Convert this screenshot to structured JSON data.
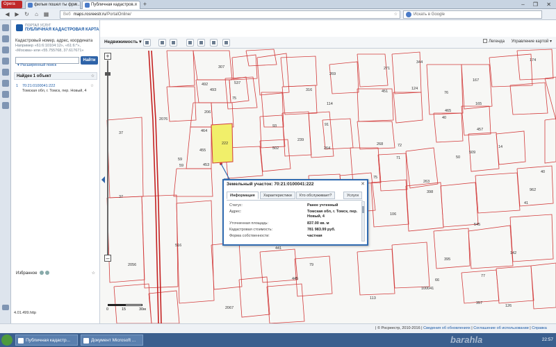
{
  "browser": {
    "opera_label": "Opera",
    "tabs": [
      {
        "label": "фильм пошел ты фри..."
      },
      {
        "label": "Публичная кадастров..."
      }
    ],
    "new_tab": "+",
    "window_controls": "– ❐ ✕",
    "address": {
      "label": "Веб",
      "domain": "maps.rosreestr.ru",
      "path": "/PortalOnline/"
    },
    "search_placeholder": "Искать в Google"
  },
  "portal": {
    "line1": "ПОРТАЛ УСЛУГ",
    "line2": "ПУБЛИЧНАЯ КАДАСТРОВАЯ КАРТА"
  },
  "search": {
    "hint_title": "Кадастровый номер, адрес, координата",
    "hint_example1": "Например «61:6:10104:12», «61:6:*»,",
    "hint_example2": "«Москва» или «55.755768, 37.617671»",
    "input_value": "",
    "find_label": "Найти",
    "advanced_label": "▾ Расширенный поиск"
  },
  "results": {
    "header": "Найден 1 объект",
    "items": [
      {
        "index": "1",
        "number": "70:21:0100041:222",
        "address": "Томская обл, г. Томск, пер. Новый, 4"
      }
    ]
  },
  "favorites": {
    "label": "Избранное"
  },
  "version": "4.01.499.http",
  "toolbar": {
    "layer_label": "Недвижимость ▾",
    "legend_label": "Легенда",
    "map_control_label": "Управление картой ▾"
  },
  "scale": {
    "l0": "0",
    "l1": "15",
    "l2": "30м"
  },
  "popup": {
    "title": "Земельный участок: 70:21:0100041:222",
    "close": "✕",
    "tabs": [
      {
        "label": "Информация"
      },
      {
        "label": "Характеристики"
      },
      {
        "label": "Кто обслуживает?"
      },
      {
        "label": "Услуги"
      }
    ],
    "rows": [
      {
        "key": "Статус:",
        "value": "Ранее учтенный"
      },
      {
        "key": "Адрес:",
        "value": "Томская обл, г. Томск, пер. Новый, 4"
      },
      {
        "key": "Уточненная площадь:",
        "value": "837.00 кв. м"
      },
      {
        "key": "Кадастровая стоимость:",
        "value": "781 983.99 руб."
      },
      {
        "key": "Форма собственности:",
        "value": "частная"
      }
    ]
  },
  "status": {
    "left": "",
    "copyright": "| © Росреестр, 2010-2016 |",
    "links": [
      "Сведения об обновлениях",
      "Соглашение об использовании",
      "Справка"
    ]
  },
  "taskbar": {
    "items": [
      {
        "label": "Публичная кадастр..."
      },
      {
        "label": "Документ Microsoft ..."
      }
    ],
    "time": "22:57"
  },
  "watermark": "barahla",
  "parcels": [
    {
      "label": "307"
    },
    {
      "label": "537"
    },
    {
      "label": "493"
    },
    {
      "label": "492"
    },
    {
      "label": "206"
    },
    {
      "label": "464"
    },
    {
      "label": "222"
    },
    {
      "label": "455"
    },
    {
      "label": "453"
    },
    {
      "label": "59"
    },
    {
      "label": "59"
    },
    {
      "label": "37"
    },
    {
      "label": "37"
    },
    {
      "label": "2076"
    },
    {
      "label": "516"
    },
    {
      "label": "2056"
    },
    {
      "label": "2067"
    },
    {
      "label": "75"
    },
    {
      "label": "269"
    },
    {
      "label": "316"
    },
    {
      "label": "114"
    },
    {
      "label": "93"
    },
    {
      "label": "91"
    },
    {
      "label": "239"
    },
    {
      "label": "502"
    },
    {
      "label": "264"
    },
    {
      "label": "271"
    },
    {
      "label": "344"
    },
    {
      "label": "451"
    },
    {
      "label": "124"
    },
    {
      "label": "76"
    },
    {
      "label": "465"
    },
    {
      "label": "174"
    },
    {
      "label": "167"
    },
    {
      "label": "165"
    },
    {
      "label": "40"
    },
    {
      "label": "457"
    },
    {
      "label": "263"
    },
    {
      "label": "268"
    },
    {
      "label": "72"
    },
    {
      "label": "71"
    },
    {
      "label": "75"
    },
    {
      "label": "441"
    },
    {
      "label": "79"
    },
    {
      "label": "445"
    },
    {
      "label": "113"
    },
    {
      "label": "106"
    },
    {
      "label": "398"
    },
    {
      "label": "50"
    },
    {
      "label": "509"
    },
    {
      "label": "14"
    },
    {
      "label": "962"
    },
    {
      "label": "545"
    },
    {
      "label": "395"
    },
    {
      "label": "66"
    },
    {
      "label": "77"
    },
    {
      "label": "100041"
    },
    {
      "label": "357"
    },
    {
      "label": "126"
    },
    {
      "label": "142"
    },
    {
      "label": "41"
    },
    {
      "label": "40"
    }
  ]
}
